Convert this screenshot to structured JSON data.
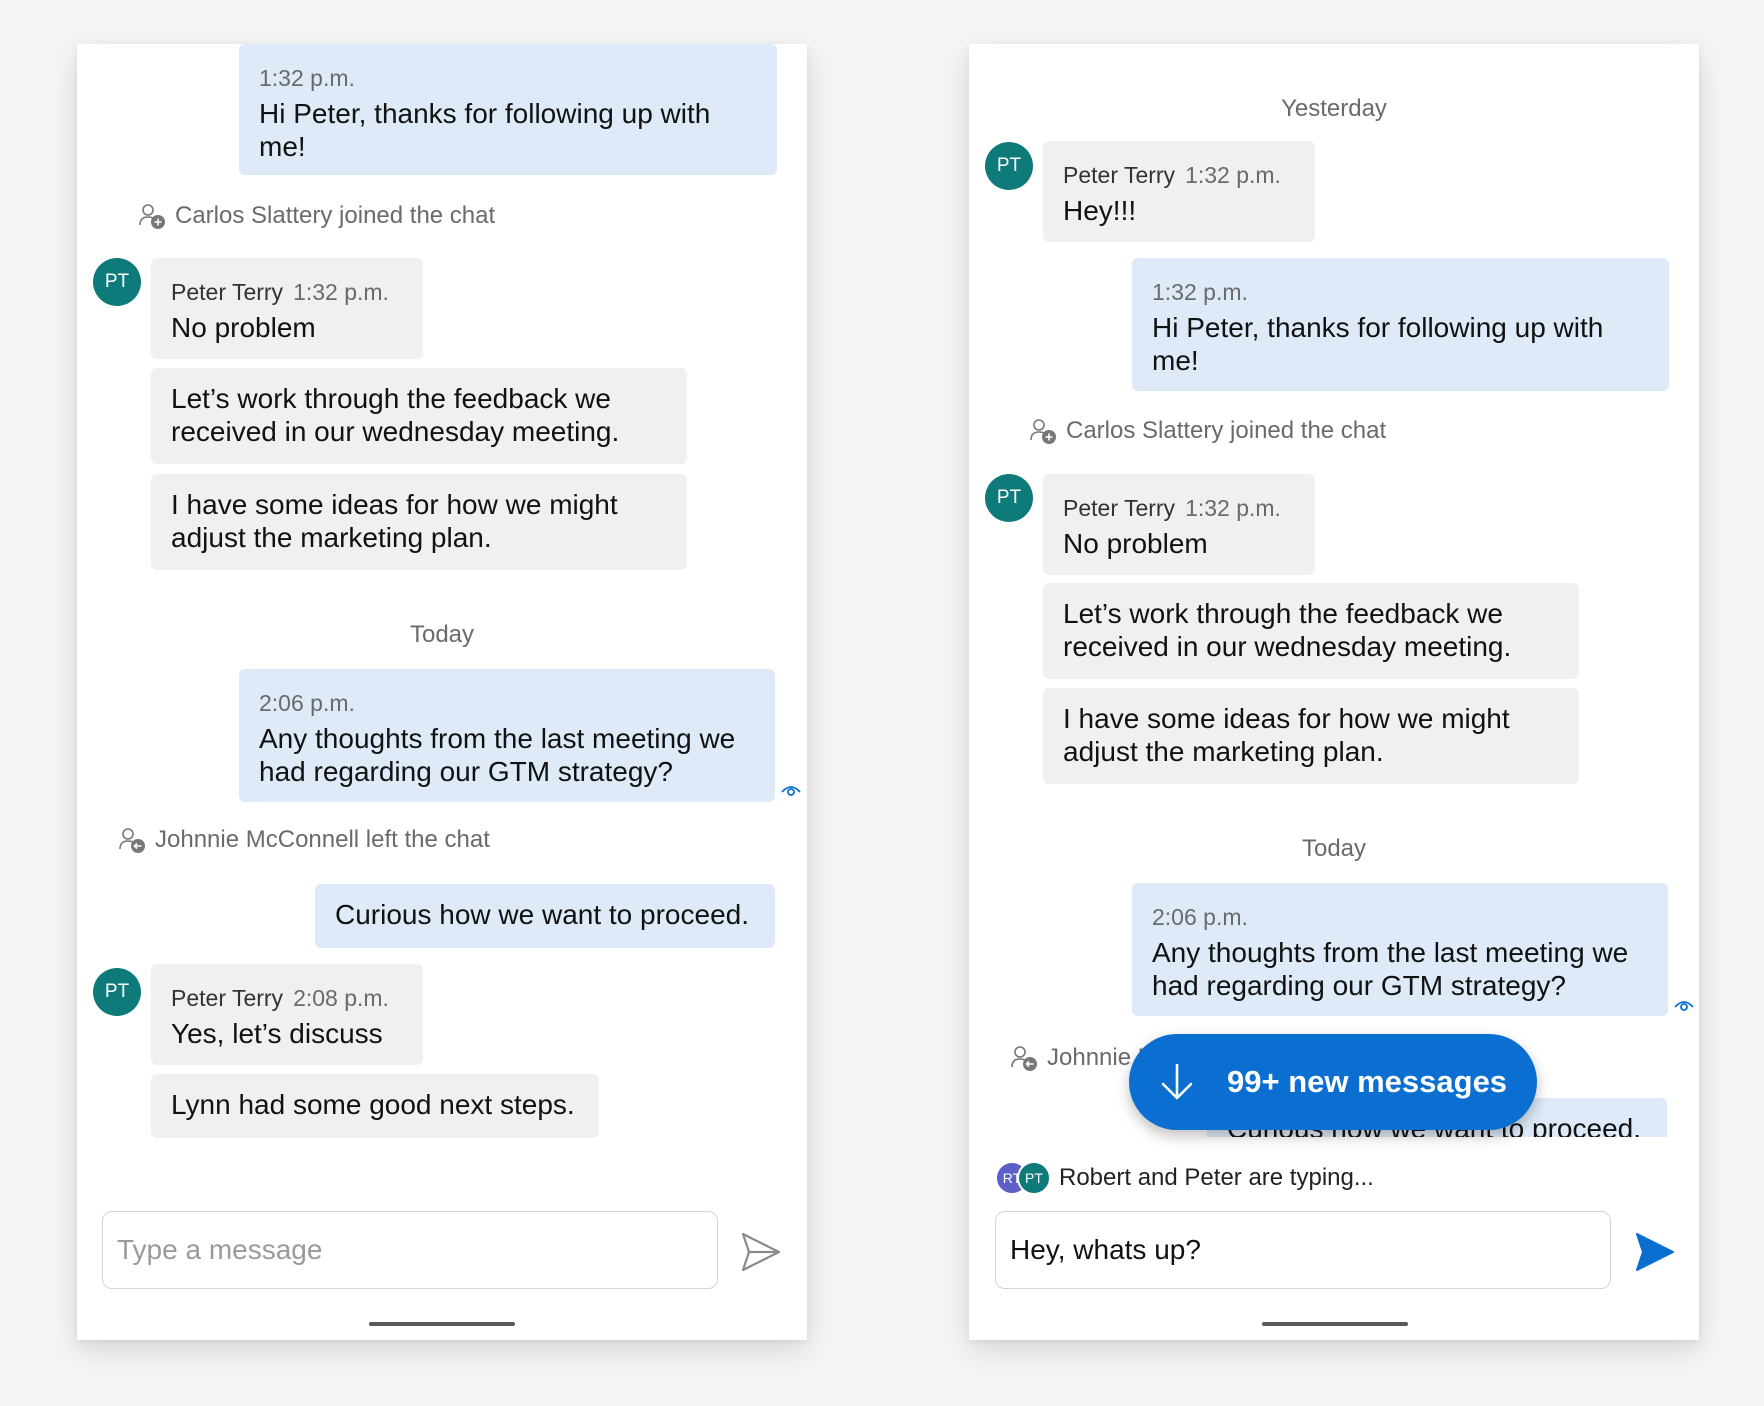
{
  "left_screen": {
    "messages": [
      {
        "time": "1:32 p.m.",
        "text": "Hi Peter, thanks for following up with me!"
      },
      {
        "system": "Carlos Slattery joined the chat"
      },
      {
        "avatar": "PT",
        "sender": "Peter Terry",
        "time": "1:32 p.m.",
        "text": "No problem"
      },
      {
        "text": "Let’s work through the feedback we received in our wednesday meeting."
      },
      {
        "text": "I have some ideas for how we might adjust the marketing plan."
      },
      {
        "date": "Today"
      },
      {
        "time": "2:06 p.m.",
        "text": "Any thoughts from the last meeting we had regarding our GTM strategy?"
      },
      {
        "system": "Johnnie McConnell left the chat"
      },
      {
        "text": "Curious how we want to proceed."
      },
      {
        "avatar": "PT",
        "sender": "Peter Terry",
        "time": "2:08 p.m.",
        "text": "Yes, let’s discuss"
      },
      {
        "text": "Lynn had some good next steps."
      }
    ],
    "composer": {
      "placeholder": "Type a message",
      "value": ""
    }
  },
  "right_screen": {
    "messages": [
      {
        "date": "Yesterday"
      },
      {
        "avatar": "PT",
        "sender": "Peter Terry",
        "time": "1:32 p.m.",
        "text": "Hey!!!"
      },
      {
        "time": "1:32 p.m.",
        "text": "Hi Peter, thanks for following up with me!"
      },
      {
        "system": "Carlos Slattery joined the chat"
      },
      {
        "avatar": "PT",
        "sender": "Peter Terry",
        "time": "1:32 p.m.",
        "text": "No problem"
      },
      {
        "text": "Let’s work through the feedback we received in our wednesday meeting."
      },
      {
        "text": "I have some ideas for how we might adjust the marketing plan."
      },
      {
        "date": "Today"
      },
      {
        "time": "2:06 p.m.",
        "text": "Any thoughts from the last meeting we had regarding our GTM strategy?"
      },
      {
        "system": "Johnnie McConnell left the chat"
      },
      {
        "text": "Curious how we want to proceed."
      }
    ],
    "jump_button": {
      "label": "99+ new messages"
    },
    "typing": {
      "avatars": [
        "RT",
        "PT"
      ],
      "text": "Robert and Peter are typing..."
    },
    "composer": {
      "placeholder": "Type a message",
      "value": "Hey, whats up?"
    }
  },
  "colors": {
    "outgoing_bubble": "#deeaf8",
    "incoming_bubble": "#f0f0f0",
    "avatar_teal": "#0e7a7a",
    "avatar_purple": "#5b5fc7",
    "accent_blue": "#0a6fd0"
  },
  "icons": {
    "join": "person-add-icon",
    "leave": "person-leave-icon",
    "seen": "eye-icon",
    "send": "send-icon",
    "jump": "arrow-down-icon"
  }
}
